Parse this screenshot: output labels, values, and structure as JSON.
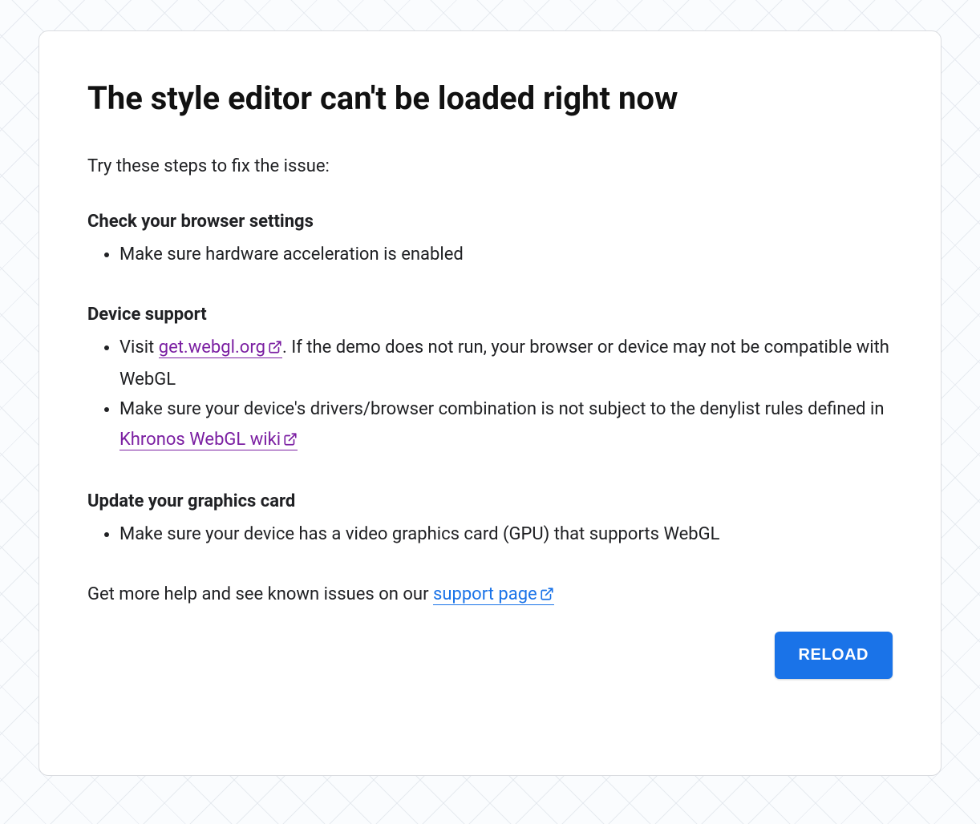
{
  "title": "The style editor can't be loaded right now",
  "intro": "Try these steps to fix the issue:",
  "sections": {
    "browser": {
      "heading": "Check your browser settings",
      "item1": "Make sure hardware acceleration is enabled"
    },
    "device": {
      "heading": "Device support",
      "item1_pre": "Visit ",
      "item1_link": "get.webgl.org",
      "item1_post": ". If the demo does not run, your browser or device may not be compatible with WebGL",
      "item2_pre": "Make sure your device's drivers/browser combination is not subject to the denylist rules defined in ",
      "item2_link": "Khronos WebGL wiki"
    },
    "gpu": {
      "heading": "Update your graphics card",
      "item1": "Make sure your device has a video graphics card (GPU) that supports WebGL"
    }
  },
  "footer": {
    "pre": "Get more help and see known issues on our ",
    "link": "support page"
  },
  "reload_label": "RELOAD",
  "colors": {
    "link_visited": "#7b1fa2",
    "link_blue": "#1a73e8",
    "button_bg": "#1a73e8"
  }
}
